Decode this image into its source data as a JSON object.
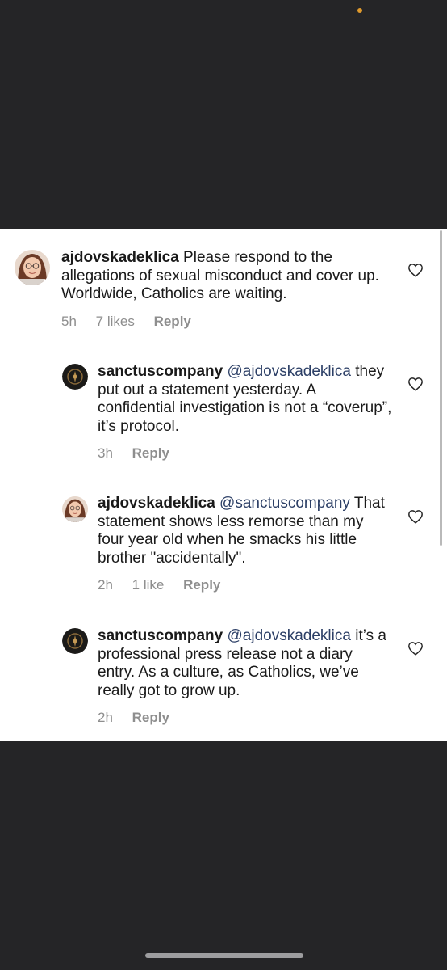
{
  "comments": [
    {
      "username": "ajdovskadeklica",
      "mention": "",
      "text": "Please respond to the allegations of sexual misconduct and cover up. Worldwide, Catholics are waiting.",
      "time": "5h",
      "likes": "7 likes",
      "reply": "Reply",
      "avatar_icon": "woman-with-glasses-avatar"
    },
    {
      "username": "sanctuscompany",
      "mention": "@ajdovskadeklica",
      "text": "they put out a statement yesterday. A confidential investigation is not a “coverup”, it’s protocol.",
      "time": "3h",
      "likes": "",
      "reply": "Reply",
      "avatar_icon": "company-logo-avatar"
    },
    {
      "username": "ajdovskadeklica",
      "mention": "@sanctuscompany",
      "text": "That statement shows less remorse than my four year old when he smacks his little brother \"accidentally\".",
      "time": "2h",
      "likes": "1 like",
      "reply": "Reply",
      "avatar_icon": "woman-with-glasses-avatar"
    },
    {
      "username": "sanctuscompany",
      "mention": "@ajdovskadeklica",
      "text": "it’s a professional press release not a diary entry. As a culture, as Catholics, we’ve really got to grow up.",
      "time": "2h",
      "likes": "",
      "reply": "Reply",
      "avatar_icon": "company-logo-avatar"
    }
  ],
  "colors": {
    "background_dark": "#252527",
    "panel": "#ffffff",
    "text": "#1a1a1a",
    "mention": "#2c3f66",
    "meta": "#8e8e8e",
    "status_dot": "#e09a2c"
  }
}
